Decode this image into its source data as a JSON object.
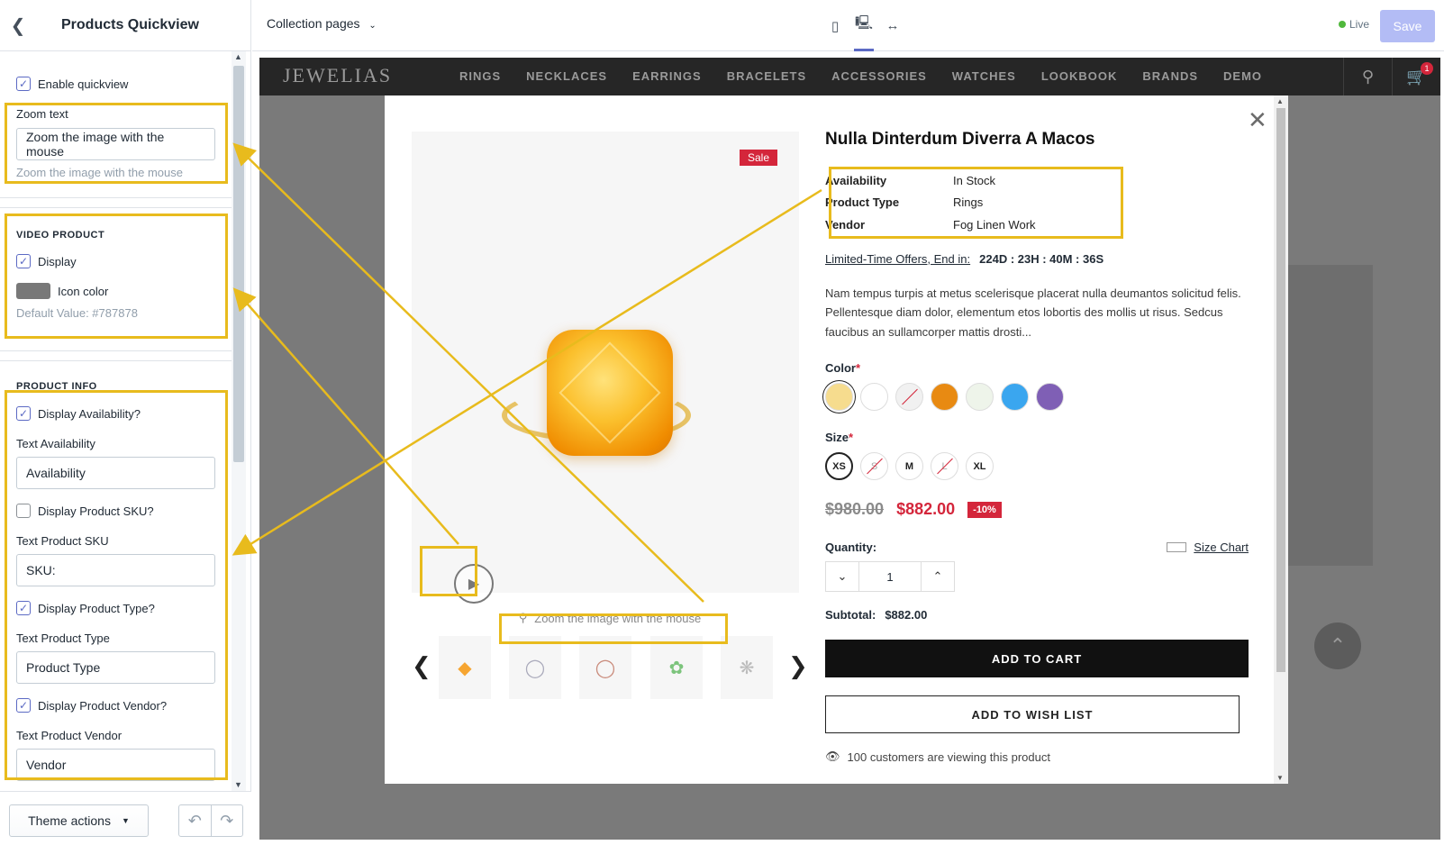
{
  "sidebar": {
    "title": "Products Quickview",
    "enable_quickview": "Enable quickview",
    "zoom_label": "Zoom text",
    "zoom_value": "Zoom the image with the mouse",
    "zoom_help": "Zoom the image with the mouse",
    "video_section": "VIDEO PRODUCT",
    "video_display": "Display",
    "icon_color_label": "Icon color",
    "icon_color_value": "#787878",
    "icon_color_help": "Default Value: #787878",
    "info_section": "PRODUCT INFO",
    "display_availability": "Display Availability?",
    "text_availability_label": "Text Availability",
    "text_availability_value": "Availability",
    "display_sku": "Display Product SKU?",
    "text_sku_label": "Text Product SKU",
    "text_sku_value": "SKU:",
    "display_type": "Display Product Type?",
    "text_type_label": "Text Product Type",
    "text_type_value": "Product Type",
    "display_vendor": "Display Product Vendor?",
    "text_vendor_label": "Text Product Vendor",
    "text_vendor_value": "Vendor",
    "theme_actions": "Theme actions"
  },
  "topbar": {
    "page_select": "Collection pages",
    "live": "Live",
    "save": "Save"
  },
  "store": {
    "logo": "JEWELIAS",
    "menu": [
      "RINGS",
      "NECKLACES",
      "EARRINGS",
      "BRACELETS",
      "ACCESSORIES",
      "WATCHES",
      "LOOKBOOK",
      "BRANDS",
      "DEMO"
    ],
    "cart_count": "1"
  },
  "product": {
    "sale_badge": "Sale",
    "zoom_hint": "Zoom the image with the mouse",
    "title": "Nulla Dinterdum Diverra A Macos",
    "meta": [
      {
        "k": "Availability",
        "v": "In Stock"
      },
      {
        "k": "Product Type",
        "v": "Rings"
      },
      {
        "k": "Vendor",
        "v": "Fog Linen Work"
      }
    ],
    "timer_label": "Limited-Time Offers, End in:",
    "timer_value": "224D : 23H : 40M : 36S",
    "description": "Nam tempus turpis at metus scelerisque placerat nulla deumantos solicitud felis. Pellentesque diam dolor, elementum etos lobortis des mollis ut risus. Sedcus faucibus an sullamcorper mattis drosti...",
    "color_label": "Color",
    "colors": [
      "#f6dc8e",
      "#ffffff",
      "#f1f1f1",
      "#e88a12",
      "#eef4ea",
      "#3aa6ef",
      "#7f5fb5"
    ],
    "size_label": "Size",
    "sizes": [
      "XS",
      "S",
      "M",
      "L",
      "XL"
    ],
    "old_price": "$980.00",
    "new_price": "$882.00",
    "discount": "-10%",
    "quantity_label": "Quantity:",
    "size_chart": "Size Chart",
    "quantity": "1",
    "subtotal_label": "Subtotal:",
    "subtotal_value": "$882.00",
    "add_to_cart": "ADD TO CART",
    "add_to_wishlist": "ADD TO WISH LIST",
    "viewing": "100 customers are viewing this product"
  },
  "colors": {
    "highlight": "#e8bb1d",
    "accent": "#5c6ac4",
    "sale": "#d4263b"
  }
}
